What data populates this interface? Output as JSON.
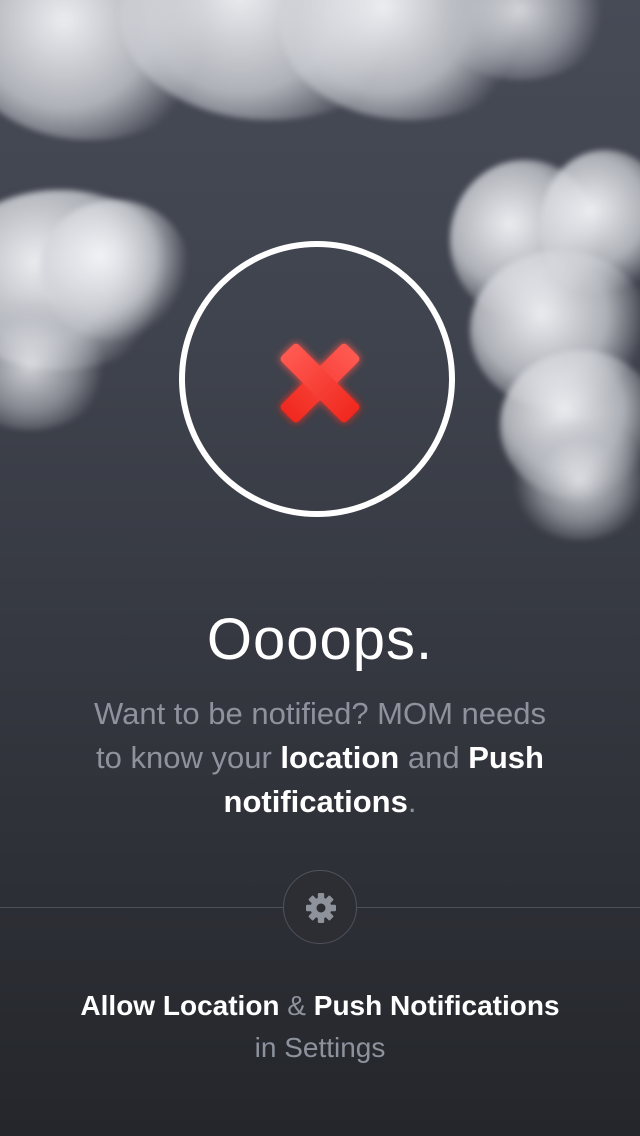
{
  "screen": {
    "headline": "Oooops.",
    "message": {
      "line1": "Want to be notified? MOM needs",
      "line2_prefix": "to know your ",
      "location_word": "location",
      "and_word": " and ",
      "push_word": "Push",
      "notifications_word": "notifications",
      "period": "."
    },
    "settings_icon": "gear-icon",
    "instruction": {
      "allow_location": "Allow Location",
      "ampersand": " & ",
      "push_notifications": "Push Notifications",
      "in_settings": "in Settings"
    }
  },
  "colors": {
    "error_red": "#ff3b30",
    "ring": "#ffffff",
    "muted_text": "#8d929d"
  },
  "icons": {
    "error": "close-x-icon",
    "settings": "gear-icon"
  }
}
